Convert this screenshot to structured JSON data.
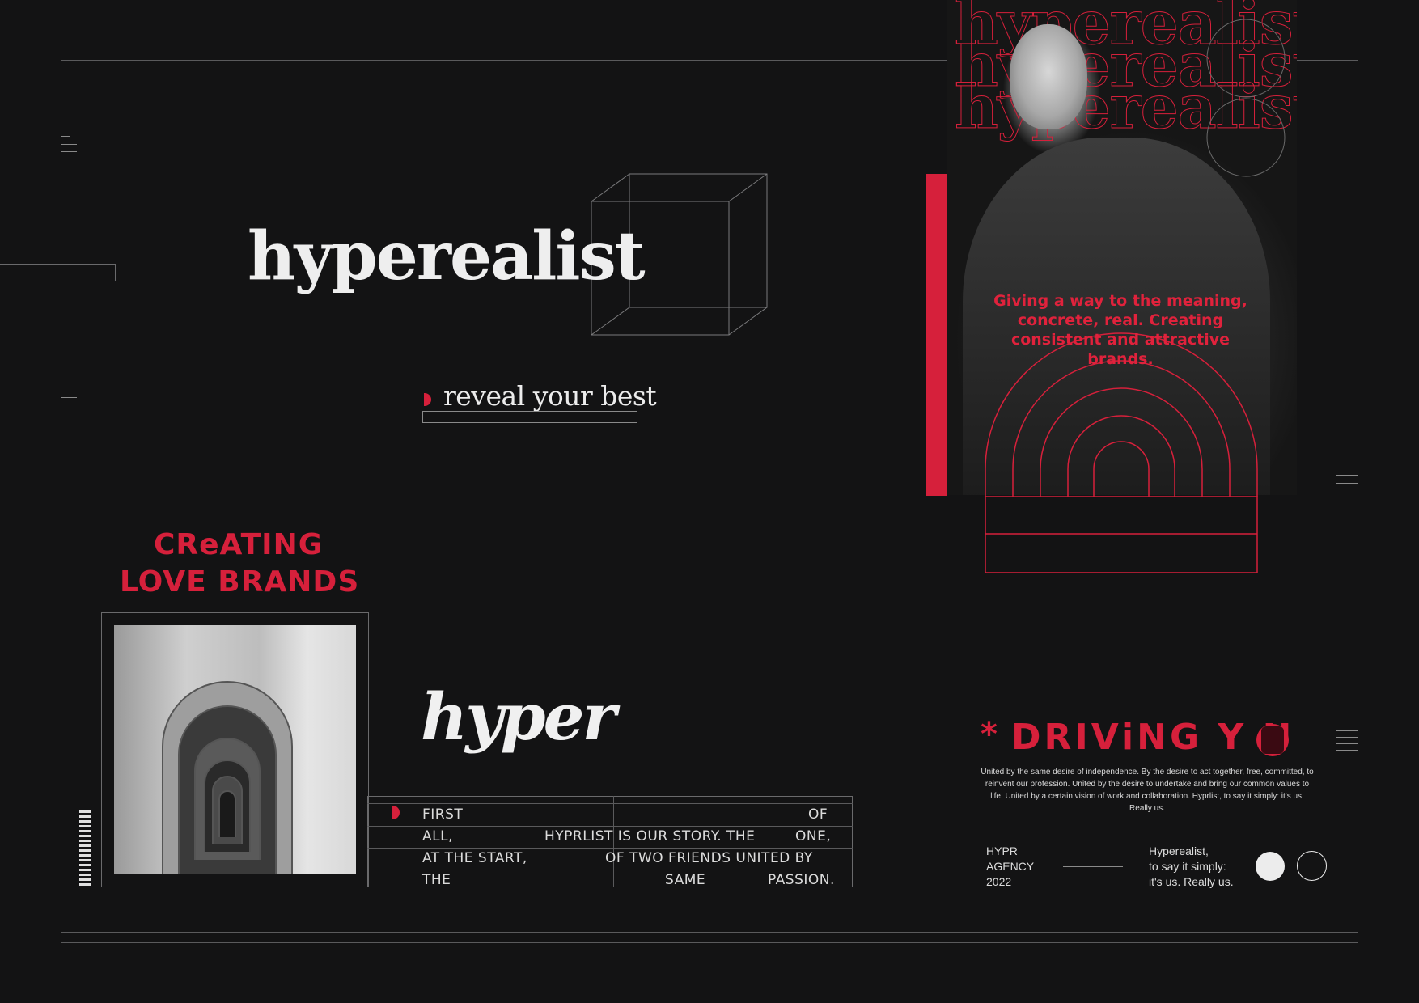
{
  "hero": {
    "word": "hyperealist",
    "tagline": "reveal your best"
  },
  "poster": {
    "repeated_word": "hyperealist",
    "quote": "Giving a way to the meaning, concrete, real. Creating consistent and attractive brands."
  },
  "creating": {
    "line1": "CReATING",
    "line2": "LOVE BRANDS"
  },
  "hyper_word": "hyper",
  "story": {
    "col_left": [
      "FIRST",
      "ALL,",
      "AT THE START,",
      "THE"
    ],
    "mid1": "HYPRLIST IS OUR STORY.",
    "the": "THE",
    "of_two": "OF  TWO  FRIENDS  UNITED  BY",
    "same": "SAME",
    "right": [
      "OF",
      "ONE,",
      "",
      "PASSION."
    ]
  },
  "driving": {
    "asterisk": "*",
    "title": "DRIViNG Y  U",
    "paragraph": "United by the same desire of independence. By the desire to act together, free, committed, to reinvent our profession. United by the desire to undertake and bring our common values to life. United by a certain vision of work and collaboration. Hyprlist, to say it simply: it's us. Really us."
  },
  "footer": {
    "agency_lines": [
      "HYPR",
      "AGENCY",
      "2022"
    ],
    "slogan_lines": [
      "Hyperealist,",
      "to say it simply:",
      "it's us. Really us."
    ]
  },
  "colors": {
    "background": "#131314",
    "accent": "#d6203b",
    "text": "#eeeeee"
  }
}
